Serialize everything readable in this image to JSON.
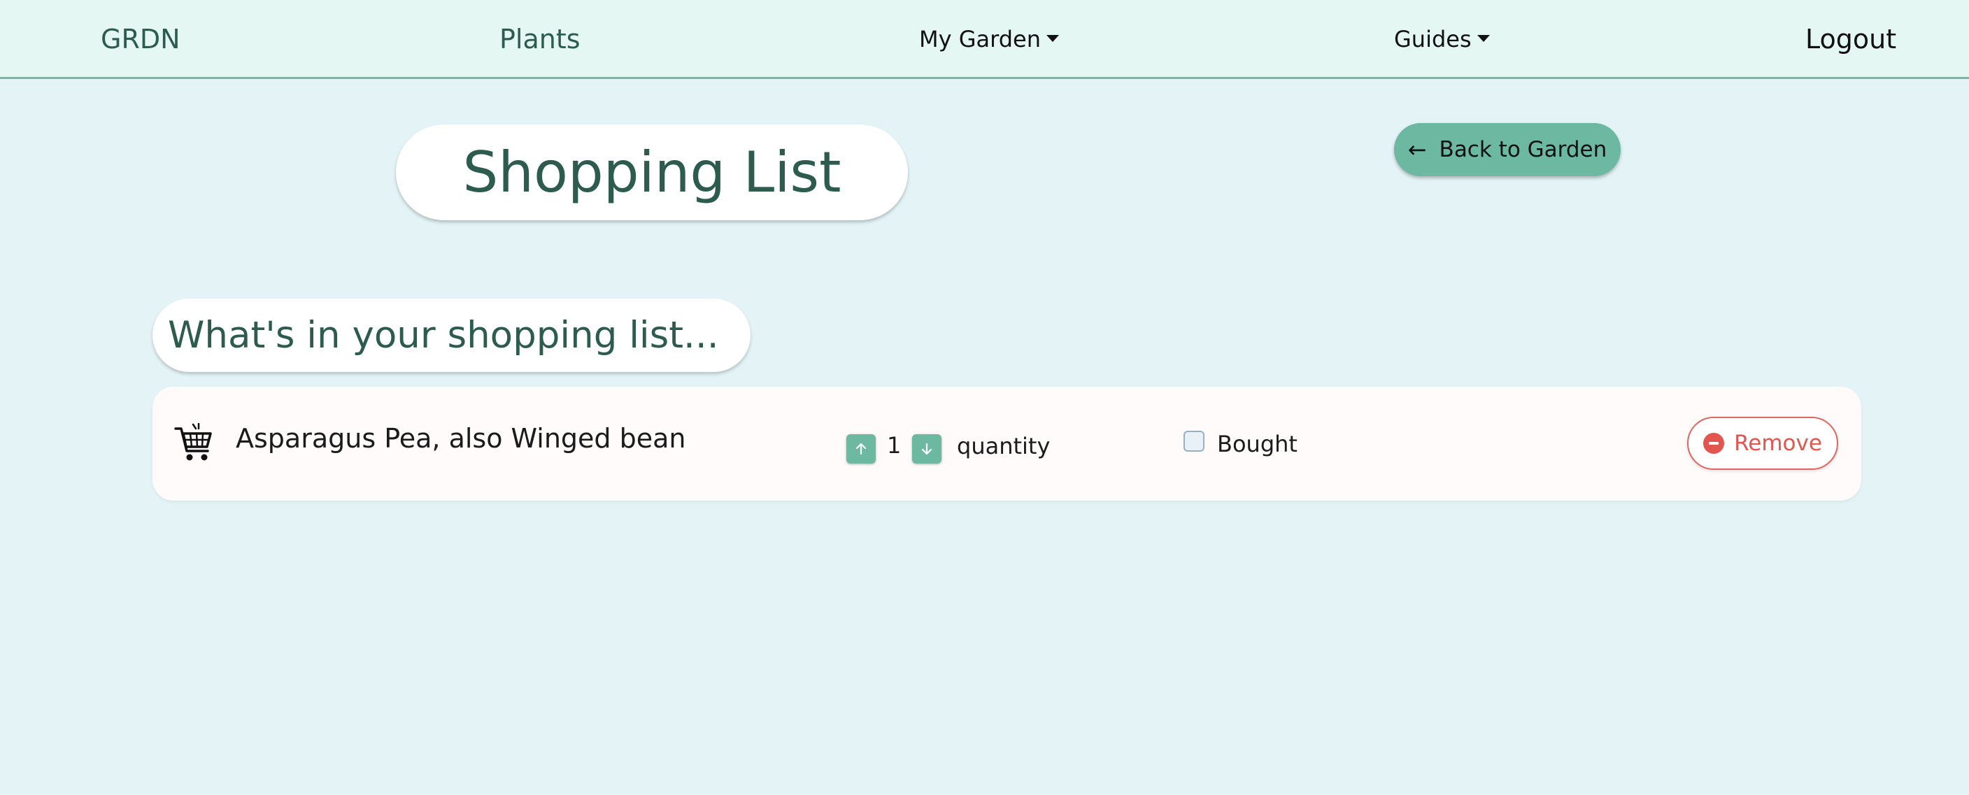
{
  "navbar": {
    "brand": "GRDN",
    "plants": "Plants",
    "my_garden": "My Garden",
    "guides": "Guides",
    "logout": "Logout"
  },
  "page": {
    "title": "Shopping List",
    "back_button": "Back to Garden",
    "subtitle": "What's in your shopping list..."
  },
  "shopping_list": {
    "items": [
      {
        "name": "Asparagus Pea, also Winged bean",
        "quantity": "1",
        "quantity_label": "quantity",
        "bought_label": "Bought",
        "bought": false,
        "remove_label": "Remove"
      }
    ]
  },
  "icons": {
    "cart": "shopping-cart-icon",
    "back": "arrow-left-icon",
    "increase": "arrow-up-icon",
    "decrease": "arrow-down-icon",
    "remove": "minus-circle-icon",
    "dropdown": "caret-down-icon"
  },
  "colors": {
    "background": "#e3f3f6",
    "navbar": "#e4f7f3",
    "accent": "#6db8a0",
    "heading": "#2d5b4e",
    "danger": "#e3564f"
  }
}
